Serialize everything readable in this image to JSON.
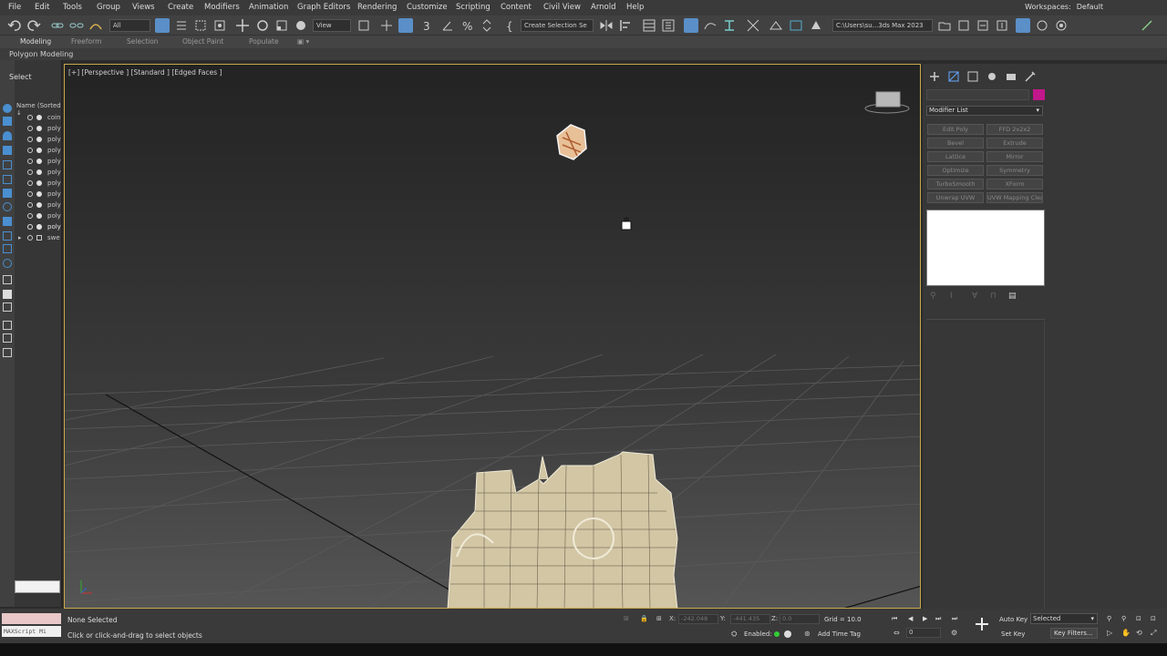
{
  "menu": [
    "File",
    "Edit",
    "Tools",
    "Group",
    "Views",
    "Create",
    "Modifiers",
    "Animation",
    "Graph Editors",
    "Rendering",
    "Customize",
    "Scripting",
    "Content",
    "Civil View",
    "Arnold",
    "Help"
  ],
  "workspace": {
    "label": "Workspaces:",
    "value": "Default"
  },
  "toolbar": {
    "filter": "All",
    "view": "View",
    "selection_set": "Create Selection Se",
    "path": "C:\\Users\\su...3ds Max 2023"
  },
  "ribbon_tabs": [
    "Modeling",
    "Freeform",
    "Selection",
    "Object Paint",
    "Populate"
  ],
  "ribbon_sub": "Polygon Modeling",
  "explorer": {
    "select_label": "Select",
    "header": "Name (Sorted ↓",
    "rows": [
      "coin",
      "poly",
      "poly",
      "poly",
      "poly",
      "poly",
      "poly",
      "poly",
      "poly",
      "poly",
      "poly",
      "swe"
    ]
  },
  "viewport": {
    "label": "[+] [Perspective ] [Standard ] [Edged Faces ]"
  },
  "command_panel": {
    "modifier_list": "Modifier List",
    "object_color": "#c0178a",
    "modifiers": [
      "Edit Poly",
      "FFD 2x2x2",
      "Bevel",
      "Extrude",
      "Lattice",
      "Mirror",
      "Optimize",
      "Symmetry",
      "TurboSmooth",
      "XForm",
      "Unwrap UVW",
      "UVW Mapping Clear"
    ]
  },
  "status": {
    "maxscript": "MAXScript Mi",
    "selection": "None Selected",
    "prompt": "Click or click-and-drag to select objects",
    "x_label": "X:",
    "x_value": "-242.048",
    "y_label": "Y:",
    "y_value": "-441.435",
    "z_label": "Z:",
    "z_value": "0.0",
    "grid": "Grid = 10.0",
    "enabled": "Enabled:",
    "add_time_tag": "Add Time Tag",
    "auto_key": "Auto Key",
    "set_key": "Set Key",
    "selected": "Selected",
    "key_filters": "Key Filters...",
    "frame": "0"
  }
}
